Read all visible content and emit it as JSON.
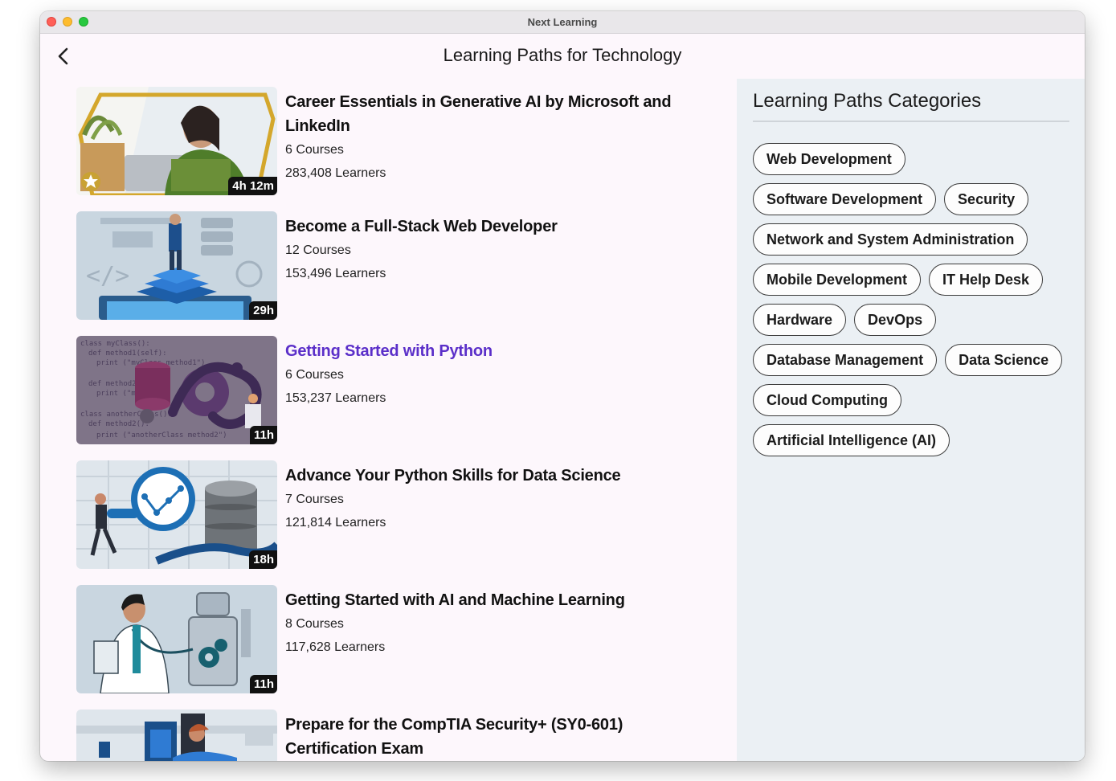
{
  "window": {
    "title": "Next Learning"
  },
  "header": {
    "title": "Learning Paths for Technology"
  },
  "paths": [
    {
      "title": "Career Essentials in Generative AI by Microsoft and LinkedIn",
      "courses": "6 Courses",
      "learners": "283,408 Learners",
      "duration": "4h 12m",
      "highlighted": false
    },
    {
      "title": "Become a Full-Stack Web Developer",
      "courses": "12 Courses",
      "learners": "153,496 Learners",
      "duration": "29h",
      "highlighted": false
    },
    {
      "title": "Getting Started with Python",
      "courses": "6 Courses",
      "learners": "153,237 Learners",
      "duration": "11h",
      "highlighted": true
    },
    {
      "title": "Advance Your Python Skills for Data Science",
      "courses": "7 Courses",
      "learners": "121,814 Learners",
      "duration": "18h",
      "highlighted": false
    },
    {
      "title": "Getting Started with AI and Machine Learning",
      "courses": "8 Courses",
      "learners": "117,628 Learners",
      "duration": "11h",
      "highlighted": false
    },
    {
      "title": "Prepare for the CompTIA Security+ (SY0-601) Certification Exam",
      "courses": "",
      "learners": "",
      "duration": "",
      "highlighted": false
    }
  ],
  "sidebar": {
    "title": "Learning Paths Categories",
    "categories": [
      "Web Development",
      "Software Development",
      "Security",
      "Network and System Administration",
      "Mobile Development",
      "IT Help Desk",
      "Hardware",
      "DevOps",
      "Database Management",
      "Data Science",
      "Cloud Computing",
      "Artificial Intelligence (AI)"
    ]
  },
  "colors": {
    "link": "#5b2fc9",
    "sidebar_bg": "#ebf0f4",
    "window_bg": "#fdf7fc"
  },
  "icons": {
    "back": "chevron-left-icon"
  }
}
